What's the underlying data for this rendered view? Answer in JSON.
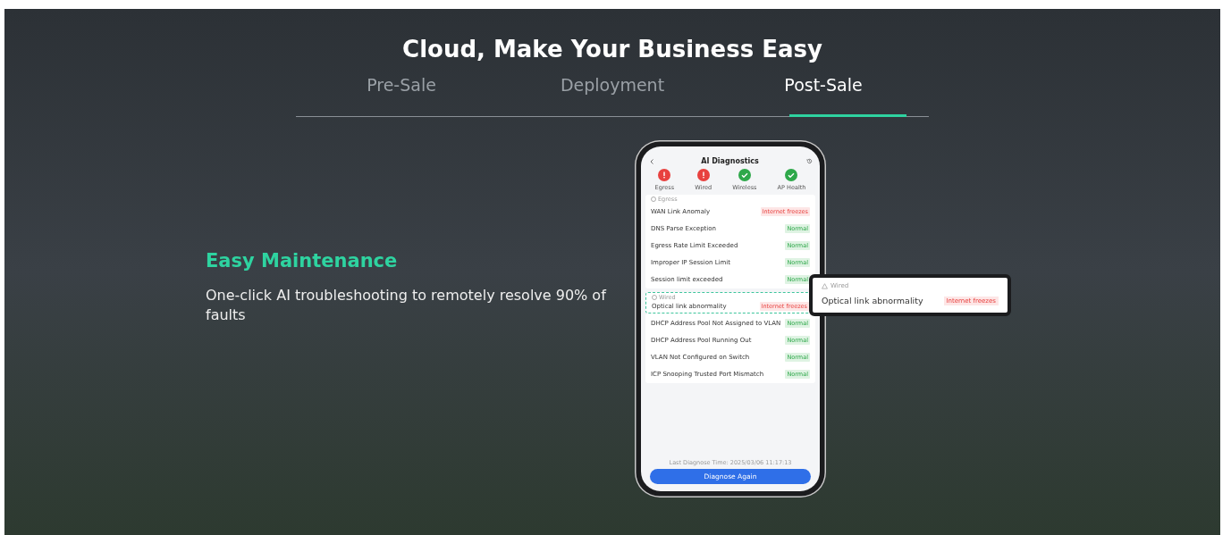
{
  "title": "Cloud, Make Your Business Easy",
  "tabs": [
    {
      "label": "Pre-Sale",
      "selected": false
    },
    {
      "label": "Deployment",
      "selected": false
    },
    {
      "label": "Post-Sale",
      "selected": true
    }
  ],
  "feature": {
    "heading": "Easy Maintenance",
    "description": "One-click AI troubleshooting to remotely resolve 90% of faults"
  },
  "phone": {
    "title": "AI Diagnostics",
    "categories": [
      {
        "label": "Egress",
        "fault": true
      },
      {
        "label": "Wired",
        "fault": true
      },
      {
        "label": "Wireless",
        "fault": false
      },
      {
        "label": "AP Health",
        "fault": false
      }
    ],
    "sections": [
      {
        "header": "Egress",
        "highlighted": false,
        "rows": [
          {
            "label": "WAN Link Anomaly",
            "result": "Internet freezes",
            "kind": "error"
          },
          {
            "label": "DNS Parse Exception",
            "result": "Normal",
            "kind": "normal"
          },
          {
            "label": "Egress Rate Limit Exceeded",
            "result": "Normal",
            "kind": "normal"
          },
          {
            "label": "Improper IP Session Limit",
            "result": "Normal",
            "kind": "normal"
          },
          {
            "label": "Session limit exceeded",
            "result": "Normal",
            "kind": "normal"
          }
        ]
      },
      {
        "header": "Wired",
        "highlighted": true,
        "rows": [
          {
            "label": "Optical link abnormality",
            "result": "Internet freezes",
            "kind": "error"
          }
        ]
      },
      {
        "highlighted": false,
        "rows": [
          {
            "label": "DHCP Address Pool Not Assigned to VLAN",
            "result": "Normal",
            "kind": "normal"
          },
          {
            "label": "DHCP Address Pool Running Out",
            "result": "Normal",
            "kind": "normal"
          },
          {
            "label": "VLAN Not Configured on Switch",
            "result": "Normal",
            "kind": "normal"
          },
          {
            "label": "ICP Snooping Trusted Port Mismatch",
            "result": "Normal",
            "kind": "normal"
          }
        ]
      }
    ],
    "last_time": "Last Diagnose Time: 2025/03/06 11:17:13",
    "button": "Diagnose Again"
  },
  "popup": {
    "header": "Wired",
    "label": "Optical link abnormality",
    "result": "Internet freezes"
  }
}
